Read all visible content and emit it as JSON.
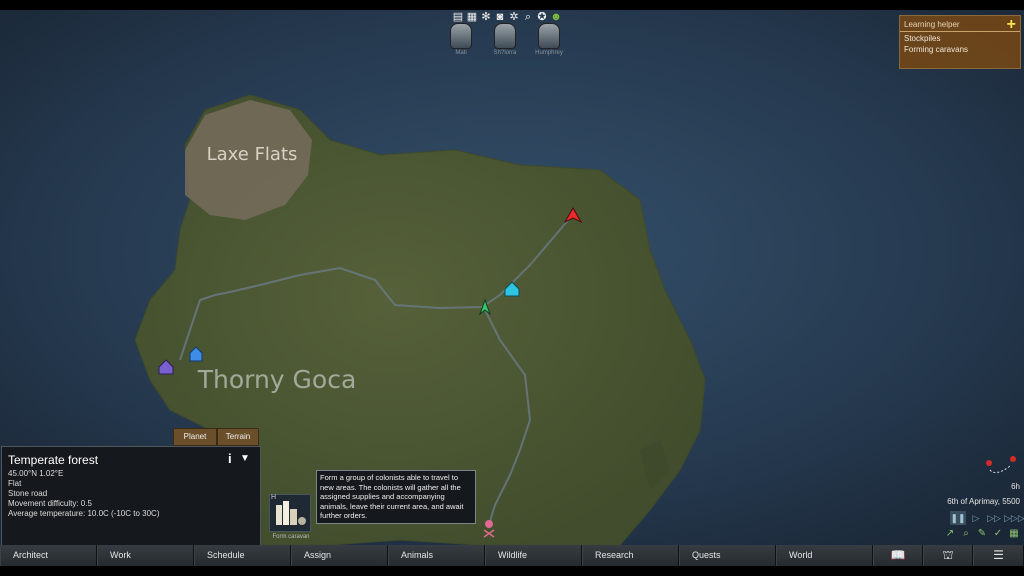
{
  "map": {
    "labels": {
      "region1": "Laxe Flats",
      "region2": "Thorny Goca"
    }
  },
  "topbar": {
    "icons": [
      "book-icon",
      "grid-icon",
      "paw-icon",
      "mask-icon",
      "paw-outline-icon",
      "search-icon",
      "film-reel-icon",
      "face-icon"
    ]
  },
  "colonists": [
    {
      "name": "Mati"
    },
    {
      "name": "Sh?lorra"
    },
    {
      "name": "Humphrey"
    }
  ],
  "learning_helper": {
    "title": "Learning helper",
    "items": [
      "Stockpiles",
      "Forming caravans"
    ]
  },
  "tabs": {
    "planet": "Planet",
    "terrain": "Terrain"
  },
  "inspect": {
    "title": "Temperate forest",
    "coords": "45.00°N 1.02°E",
    "hilliness": "Flat",
    "road": "Stone road",
    "movement": "Movement difficulty: 0.5",
    "temperature": "Average temperature: 10.0C (-10C to 30C)"
  },
  "caravan": {
    "hotkey": "H",
    "label": "Form caravan"
  },
  "tooltip": {
    "text": "Form a group of colonists able to travel to new areas. The colonists will gather all the assigned supplies and accompanying animals, leave their current area, and await further orders."
  },
  "time": {
    "hour": "6h",
    "date": "6th of Aprimay, 5500"
  },
  "bottom_tabs": [
    "Architect",
    "Work",
    "Schedule",
    "Assign",
    "Animals",
    "Wildlife",
    "Research",
    "Quests",
    "World"
  ],
  "bottom_icons": [
    "book-icon",
    "factions-icon",
    "menu-icon"
  ],
  "colors": {
    "accent_gold": "#f5e64c",
    "ocean": "#2a3d52",
    "land": "#4d5a32"
  }
}
